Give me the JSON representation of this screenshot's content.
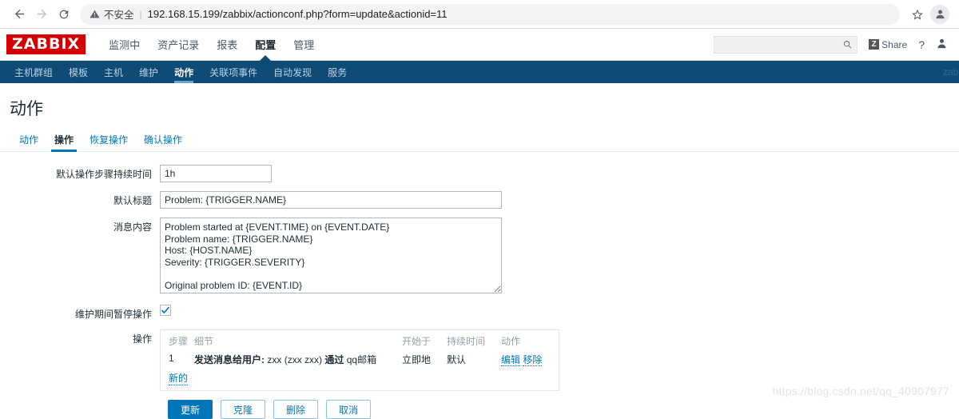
{
  "browser": {
    "back_icon": "back-arrow-icon",
    "forward_icon": "forward-arrow-icon",
    "reload_icon": "reload-icon",
    "security_warning": "不安全",
    "url": "192.168.15.199/zabbix/actionconf.php?form=update&actionid=11",
    "star_icon": "★",
    "profile_icon": "profile-avatar-icon"
  },
  "zabbix_header": {
    "logo": "ZABBIX",
    "main_nav": [
      {
        "label": "监测中",
        "active": false
      },
      {
        "label": "资产记录",
        "active": false
      },
      {
        "label": "报表",
        "active": false
      },
      {
        "label": "配置",
        "active": true
      },
      {
        "label": "管理",
        "active": false
      }
    ],
    "search": {
      "value": "",
      "placeholder": ""
    },
    "share_label": "Share",
    "share_badge": "Z",
    "help_label": "?",
    "brand_color": "#d40000",
    "subnav_color": "#0f4b75"
  },
  "sub_nav": {
    "items": [
      {
        "label": "主机群组",
        "active": false
      },
      {
        "label": "模板",
        "active": false
      },
      {
        "label": "主机",
        "active": false
      },
      {
        "label": "维护",
        "active": false
      },
      {
        "label": "动作",
        "active": true
      },
      {
        "label": "关联项事件",
        "active": false
      },
      {
        "label": "自动发现",
        "active": false
      },
      {
        "label": "服务",
        "active": false
      }
    ],
    "right_text": "zab"
  },
  "page": {
    "title": "动作",
    "tabs": [
      {
        "label": "动作",
        "active": false
      },
      {
        "label": "操作",
        "active": true
      },
      {
        "label": "恢复操作",
        "active": false
      },
      {
        "label": "确认操作",
        "active": false
      }
    ]
  },
  "form": {
    "default_step_duration": {
      "label": "默认操作步骤持续时间",
      "value": "1h"
    },
    "default_subject": {
      "label": "默认标题",
      "value": "Problem: {TRIGGER.NAME}"
    },
    "message_content": {
      "label": "消息内容",
      "value": "Problem started at {EVENT.TIME} on {EVENT.DATE}\nProblem name: {TRIGGER.NAME}\nHost: {HOST.NAME}\nSeverity: {TRIGGER.SEVERITY}\n\nOriginal problem ID: {EVENT.ID}\n{TRIGGER.URL}"
    },
    "pause_on_maintenance": {
      "label": "维护期间暂停操作",
      "checked": true
    },
    "operations": {
      "label": "操作",
      "columns": [
        "步骤",
        "细节",
        "开始于",
        "持续时间",
        "动作"
      ],
      "rows": [
        {
          "step": "1",
          "detail_bold": "发送消息给用户:",
          "detail_user": "zxx (zxx zxx)",
          "detail_via": "通过",
          "detail_media": "qq邮箱",
          "start": "立即地",
          "duration": "默认",
          "action_edit": "编辑",
          "action_remove": "移除"
        }
      ],
      "new_link": "新的"
    },
    "buttons": [
      {
        "label": "更新",
        "type": "primary"
      },
      {
        "label": "克隆",
        "type": "secondary"
      },
      {
        "label": "删除",
        "type": "secondary"
      },
      {
        "label": "取消",
        "type": "secondary"
      }
    ]
  },
  "watermark": "https://blog.csdn.net/qq_40907977"
}
